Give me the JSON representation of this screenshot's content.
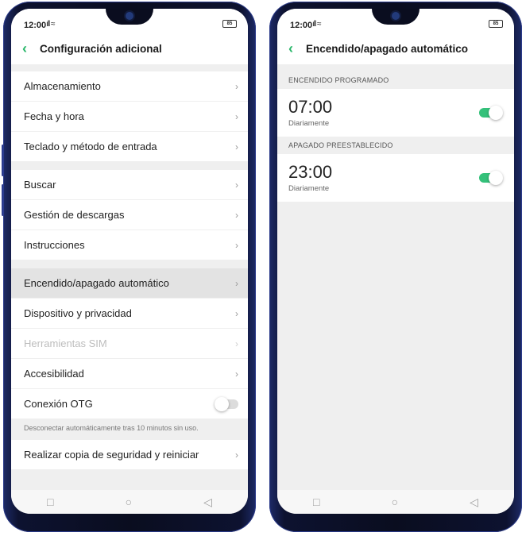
{
  "colors": {
    "accent": "#2bb76b",
    "toggle_on": "#34c17a",
    "frame": "#0a0d1f"
  },
  "left": {
    "status": {
      "time": "12:00",
      "signal": "᷂ıl",
      "battery": "85"
    },
    "title": "Configuración adicional",
    "groups": [
      [
        "Almacenamiento",
        "Fecha y hora",
        "Teclado y método de entrada"
      ],
      [
        "Buscar",
        "Gestión de descargas",
        "Instrucciones"
      ],
      [
        "Encendido/apagado automático",
        "Dispositivo y privacidad",
        "Herramientas SIM",
        "Accesibilidad"
      ]
    ],
    "otg_label": "Conexión OTG",
    "otg_on": false,
    "otg_note": "Desconectar automáticamente tras 10 minutos sin uso.",
    "backup_label": "Realizar copia de seguridad y reiniciar",
    "chevron": "›",
    "nav_icons": [
      "square-icon",
      "circle-icon",
      "triangle-back-icon"
    ]
  },
  "right": {
    "status": {
      "time": "12:00",
      "signal": "᷂ıl",
      "battery": "85"
    },
    "title": "Encendido/apagado automático",
    "on_section": {
      "header": "ENCENDIDO PROGRAMADO",
      "time": "07:00",
      "freq": "Diariamente",
      "enabled": true
    },
    "off_section": {
      "header": "APAGADO PREESTABLECIDO",
      "time": "23:00",
      "freq": "Diariamente",
      "enabled": true
    }
  }
}
